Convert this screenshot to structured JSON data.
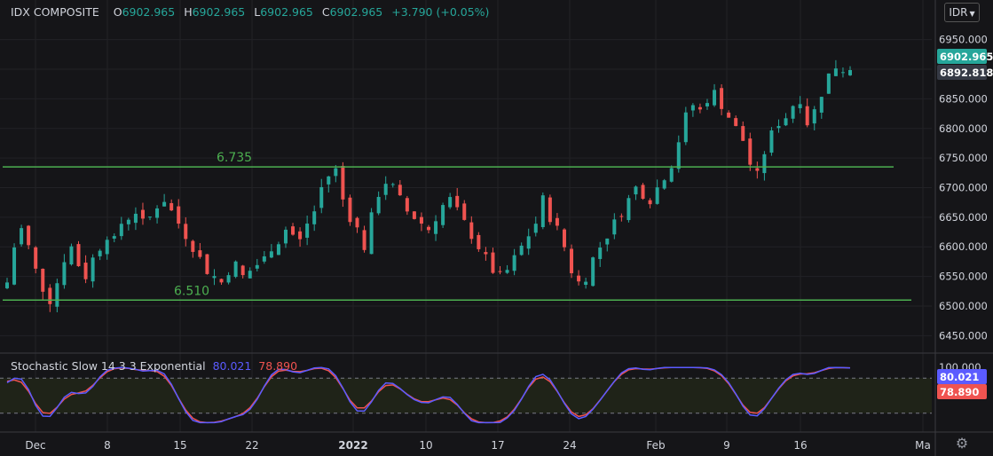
{
  "legend": {
    "symbol": "IDX COMPOSITE",
    "open_label": "O",
    "open": "6902.965",
    "high_label": "H",
    "high": "6902.965",
    "low_label": "L",
    "low": "6902.965",
    "close_label": "C",
    "close": "6902.965",
    "change": "+3.790 (+0.05%)"
  },
  "currency": "IDR",
  "stochastic": {
    "name": "Stochastic Slow 14 3 3 Exponential",
    "k_value": "80.021",
    "d_value": "78.890"
  },
  "colors": {
    "up": "#26a69a",
    "down": "#ef5350",
    "stoch_k": "#5b5bff",
    "stoch_d": "#ef5350",
    "hline": "#4caf50",
    "background": "#151518"
  },
  "chart_data": [
    {
      "type": "candlestick",
      "ylim": [
        6425,
        6975
      ],
      "y_ticks": [
        "6450.000",
        "6500.000",
        "6550.000",
        "6600.000",
        "6650.000",
        "6700.000",
        "6750.000",
        "6800.000",
        "6850.000",
        "6900.000",
        "6950.000"
      ],
      "x_tick_labels": [
        "Dec",
        "8",
        "15",
        "22",
        "2022",
        "10",
        "17",
        "24",
        "Feb",
        "9",
        "16",
        "Ma"
      ],
      "price_labels": [
        {
          "value": 6902.965,
          "text": "6902.965",
          "style": "last"
        },
        {
          "value": 6892.818,
          "text": "6892.818",
          "style": "ref"
        }
      ],
      "horizontal_lines": [
        {
          "value": 6735,
          "label": "6.735"
        },
        {
          "value": 6510,
          "label": "6.510"
        }
      ],
      "close_path": [
        6540,
        6600,
        6630,
        6600,
        6560,
        6530,
        6510,
        6540,
        6580,
        6600,
        6570,
        6550,
        6580,
        6600,
        6620,
        6610,
        6640,
        6650,
        6660,
        6640,
        6650,
        6670,
        6680,
        6660,
        6640,
        6620,
        6600,
        6580,
        6560,
        6550,
        6540,
        6560,
        6570,
        6550,
        6560,
        6570,
        6580,
        6600,
        6610,
        6630,
        6620,
        6610,
        6640,
        6660,
        6700,
        6720,
        6730,
        6680,
        6650,
        6630,
        6600,
        6650,
        6690,
        6710,
        6700,
        6680,
        6660,
        6650,
        6640,
        6630,
        6650,
        6670,
        6680,
        6660,
        6640,
        6620,
        6600,
        6580,
        6560,
        6550,
        6560,
        6580,
        6600,
        6620,
        6640,
        6680,
        6650,
        6630,
        6600,
        6560,
        6540,
        6550,
        6580,
        6600,
        6620,
        6640,
        6660,
        6680,
        6700,
        6690,
        6680,
        6700,
        6720,
        6740,
        6780,
        6820,
        6840,
        6830,
        6850,
        6860,
        6840,
        6820,
        6800,
        6780,
        6740,
        6720,
        6760,
        6790,
        6810,
        6820,
        6840,
        6850,
        6810,
        6830,
        6860,
        6890,
        6905,
        6900,
        6903
      ]
    },
    {
      "type": "line",
      "name": "Stochastic Slow 14 3 3 Exponential",
      "ylim": [
        0,
        100
      ],
      "y_ticks": [
        "100.000"
      ],
      "bands": [
        80,
        20
      ],
      "value_labels": [
        {
          "value": 80.021,
          "text": "80.021",
          "series": "K"
        },
        {
          "value": 78.89,
          "text": "78.890",
          "series": "D"
        }
      ]
    }
  ]
}
